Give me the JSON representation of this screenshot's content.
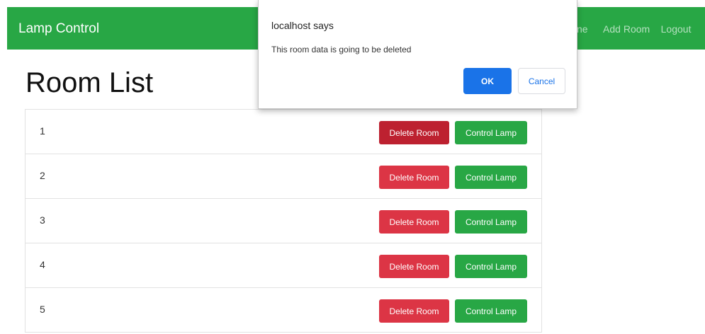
{
  "navbar": {
    "brand": "Lamp Control",
    "links": [
      {
        "label": "ne"
      },
      {
        "label": "Add Room"
      },
      {
        "label": "Logout"
      }
    ],
    "color": "#28a745"
  },
  "page_title": "Room List",
  "rooms": [
    {
      "name": "1",
      "delete_label": "Delete Room",
      "control_label": "Control Lamp"
    },
    {
      "name": "2",
      "delete_label": "Delete Room",
      "control_label": "Control Lamp"
    },
    {
      "name": "3",
      "delete_label": "Delete Room",
      "control_label": "Control Lamp"
    },
    {
      "name": "4",
      "delete_label": "Delete Room",
      "control_label": "Control Lamp"
    },
    {
      "name": "5",
      "delete_label": "Delete Room",
      "control_label": "Control Lamp"
    }
  ],
  "dialog": {
    "title": "localhost says",
    "message": "This room data is going to be deleted",
    "ok_label": "OK",
    "cancel_label": "Cancel"
  },
  "colors": {
    "success": "#28a745",
    "danger": "#dc3545",
    "danger_active": "#bd2130",
    "dialog_accent": "#1a73e8"
  }
}
